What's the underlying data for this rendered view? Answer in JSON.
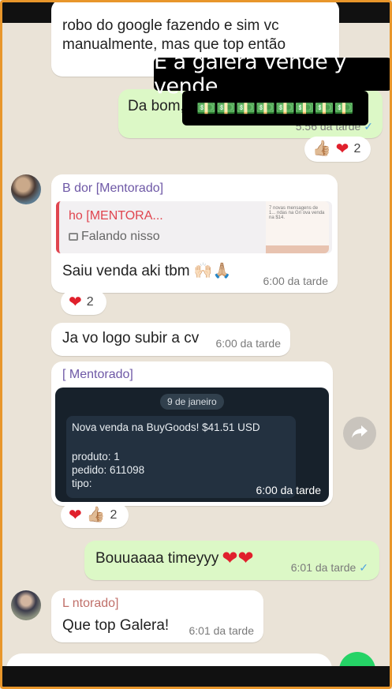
{
  "messages": {
    "m1": {
      "text": "robo do google fazendo e sim vc manualmente, mas que top então"
    },
    "m2": {
      "text": "Da bom,",
      "time": "5:56 da tarde"
    },
    "r2": {
      "count": "2"
    },
    "m3": {
      "sender": "B         dor [Mentorado]",
      "quote_sender": "        ho [MENTORA...",
      "quote_text": "Falando nisso",
      "text": "Saiu venda aki tbm 🙌🏻🙏🏼",
      "time": "6:00 da tarde",
      "thumb_text": "7 novas mensagens de 1...  ndas na Gri  ova venda na  $14."
    },
    "r3": {
      "count": "2"
    },
    "m4": {
      "text": "Ja vo logo subir a cv",
      "time": "6:00 da tarde"
    },
    "m5": {
      "sender": "[              Mentorado]",
      "img_date": "9 de janeiro",
      "img_title": "Nova venda na BuyGoods!",
      "img_amount": "$41.51 USD",
      "img_produto": "produto: 1",
      "img_pedido": "pedido: 611098",
      "img_tipo": "tipo:",
      "img_time": "6:00 da tarde"
    },
    "r5": {
      "count": "2"
    },
    "m6": {
      "text": "Bouuaaaa timeyyy",
      "time": "6:01 da tarde"
    },
    "m7": {
      "sender": "L          ntorado]",
      "text": "Que top Galera!",
      "time": "6:01 da tarde"
    }
  },
  "overlay": {
    "caption": "E a galera vende y vende",
    "money_emoji": "💵💵💵💵💵💵💵💵"
  },
  "colors": {
    "accent": "#25d366",
    "outgoing": "#dcf8c6",
    "incoming": "#ffffff",
    "reaction_heart": "#e0202c"
  }
}
